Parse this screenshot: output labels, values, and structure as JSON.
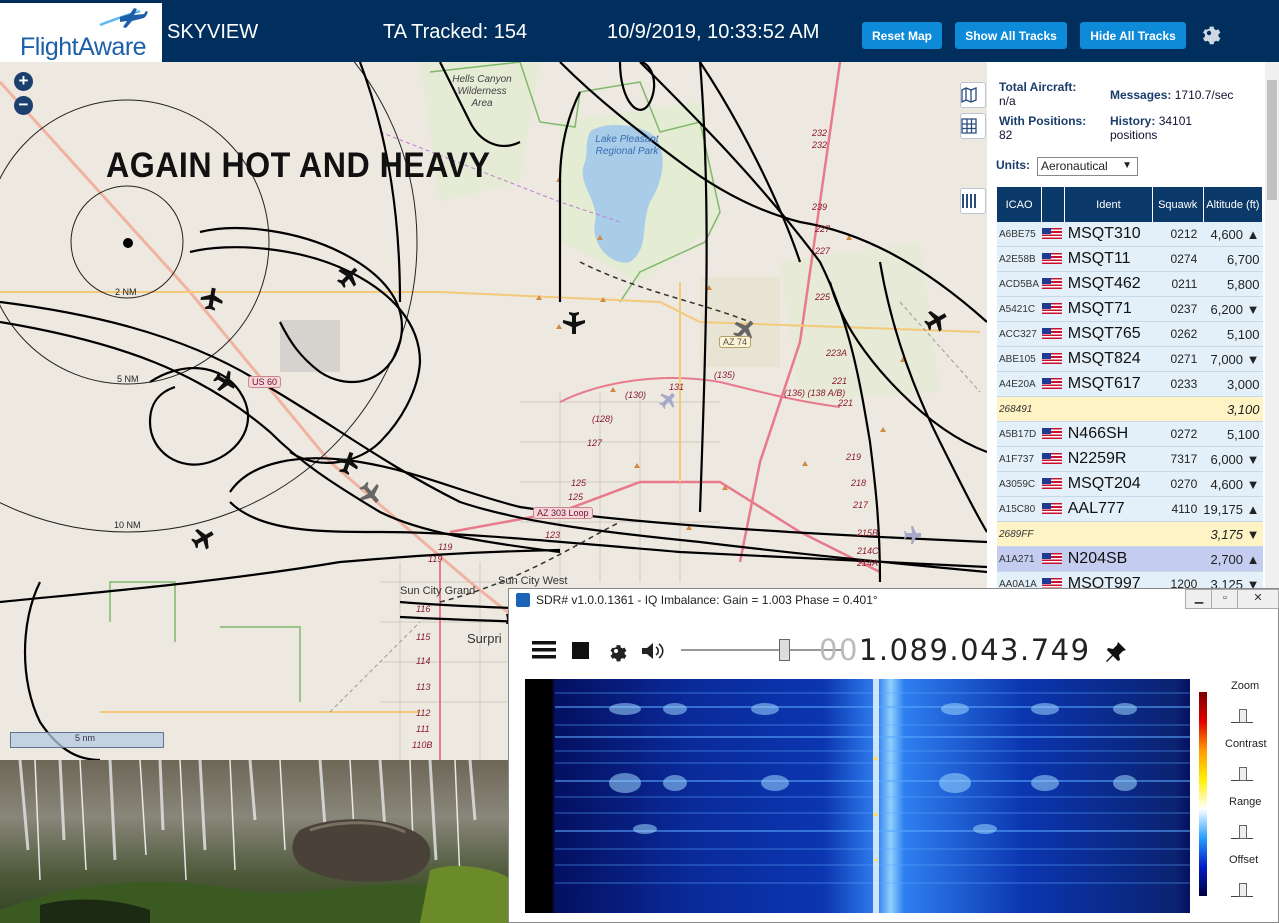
{
  "header": {
    "logo_text": "FlightAware",
    "app_name": "SKYVIEW",
    "tracked": "TA Tracked: 154",
    "datetime": "10/9/2019, 10:33:52 AM",
    "buttons": {
      "reset_map": "Reset Map",
      "show_all": "Show All Tracks",
      "hide_all": "Hide All Tracks"
    },
    "settings_icon": "gear-icon"
  },
  "map": {
    "overlay_text": "AGAIN HOT AND HEAVY",
    "zoom_in": "+",
    "zoom_out": "−",
    "scale_label": "5 nm",
    "range_rings": [
      "2 NM",
      "5 NM",
      "10 NM"
    ],
    "wilderness": "Hells Canyon Wilderness Area",
    "lake": "Lake Pleasant Regional Park",
    "places": [
      "Sun City Grand",
      "Sun City West",
      "Surpri"
    ],
    "shields": [
      "AZ 74",
      "US 60",
      "AZ 303 Loop"
    ],
    "route_numbers": [
      "232",
      "232",
      "239",
      "227",
      "227",
      "225",
      "223A",
      "221",
      "221",
      "219",
      "218",
      "217",
      "215B",
      "214C",
      "214A",
      "(136) (138 A/B)",
      "(135)",
      "131",
      "(130)",
      "(128)",
      "127",
      "125",
      "125",
      "123",
      "119",
      "119",
      "116",
      "115",
      "114",
      "113",
      "112",
      "111",
      "110B"
    ],
    "controls": [
      "map-icon",
      "grid-icon",
      "columns-icon"
    ]
  },
  "panel": {
    "total_aircraft_label": "Total Aircraft:",
    "total_aircraft_value": "n/a",
    "messages_label": "Messages:",
    "messages_value": "1710.7/sec",
    "with_positions_label": "With Positions:",
    "with_positions_value": "82",
    "history_label": "History:",
    "history_value": "34101",
    "history_unit": "positions",
    "units_label": "Units:",
    "units_value": "Aeronautical",
    "columns": [
      "ICAO",
      "",
      "Ident",
      "Squawk",
      "Altitude (ft)"
    ],
    "rows": [
      {
        "icao": "A6BE75",
        "flag": true,
        "ident": "MSQT310",
        "squawk": "0212",
        "alt": "4,600 ▲",
        "style": "row"
      },
      {
        "icao": "A2E58B",
        "flag": true,
        "ident": "MSQT11",
        "squawk": "0274",
        "alt": "6,700",
        "style": "row"
      },
      {
        "icao": "ACD5BA",
        "flag": true,
        "ident": "MSQT462",
        "squawk": "0211",
        "alt": "5,800",
        "style": "row"
      },
      {
        "icao": "A5421C",
        "flag": true,
        "ident": "MSQT71",
        "squawk": "0237",
        "alt": "6,200 ▼",
        "style": "row"
      },
      {
        "icao": "ACC327",
        "flag": true,
        "ident": "MSQT765",
        "squawk": "0262",
        "alt": "5,100",
        "style": "row"
      },
      {
        "icao": "ABE105",
        "flag": true,
        "ident": "MSQT824",
        "squawk": "0271",
        "alt": "7,000 ▼",
        "style": "row"
      },
      {
        "icao": "A4E20A",
        "flag": true,
        "ident": "MSQT617",
        "squawk": "0233",
        "alt": "3,000",
        "style": "row"
      },
      {
        "icao": "268491",
        "flag": false,
        "ident": "",
        "squawk": "",
        "alt": "3,100",
        "style": "yellow"
      },
      {
        "icao": "A5B17D",
        "flag": true,
        "ident": "N466SH",
        "squawk": "0272",
        "alt": "5,100",
        "style": "row"
      },
      {
        "icao": "A1F737",
        "flag": true,
        "ident": "N2259R",
        "squawk": "7317",
        "alt": "6,000 ▼",
        "style": "row"
      },
      {
        "icao": "A3059C",
        "flag": true,
        "ident": "MSQT204",
        "squawk": "0270",
        "alt": "4,600 ▼",
        "style": "row"
      },
      {
        "icao": "A15C80",
        "flag": true,
        "ident": "AAL777",
        "squawk": "4110",
        "alt": "19,175 ▲",
        "style": "row"
      },
      {
        "icao": "2689FF",
        "flag": false,
        "ident": "",
        "squawk": "",
        "alt": "3,175 ▼",
        "style": "yellow"
      },
      {
        "icao": "A1A271",
        "flag": true,
        "ident": "N204SB",
        "squawk": "",
        "alt": "2,700 ▲",
        "style": "sel"
      },
      {
        "icao": "AA0A1A",
        "flag": true,
        "ident": "MSQT997",
        "squawk": "1200",
        "alt": "3,125 ▼",
        "style": "row"
      }
    ]
  },
  "sdr": {
    "title": "SDR# v1.0.0.1361 - IQ Imbalance: Gain = 1.003 Phase = 0.401°",
    "freq_dim": "00",
    "freq": "1.089.043.749",
    "toolbar_icons": [
      "menu-icon",
      "stop-icon",
      "gear-icon",
      "speaker-icon",
      "pin-icon"
    ],
    "side_labels": [
      "Zoom",
      "Contrast",
      "Range",
      "Offset"
    ],
    "window_buttons": [
      "minimize",
      "maximize",
      "close"
    ]
  }
}
